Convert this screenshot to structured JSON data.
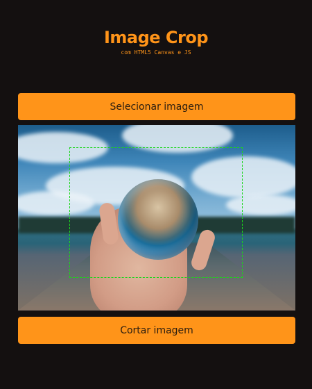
{
  "header": {
    "title": "Image Crop",
    "subtitle": "com HTML5 Canvas e JS"
  },
  "buttons": {
    "select_label": "Selecionar imagem",
    "crop_label": "Cortar imagem"
  },
  "colors": {
    "background": "#141010",
    "accent": "#ff9419",
    "crop_border": "#1bd61b"
  }
}
